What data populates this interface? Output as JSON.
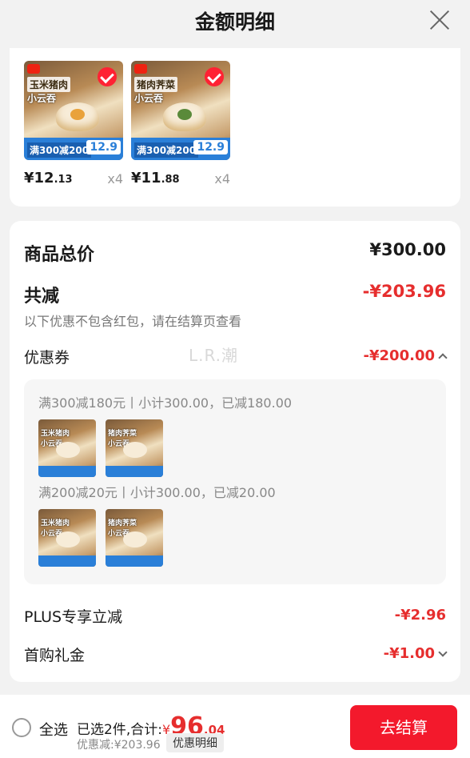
{
  "header": {
    "title": "金额明细"
  },
  "products": [
    {
      "line1": "玉米猪肉",
      "line2": "小云吞",
      "promo": "满300减200",
      "badge_price": "12.9",
      "price_int": "¥12",
      "price_dec": ".13",
      "qty": "x4",
      "filling": "corn"
    },
    {
      "line1": "猪肉荠菜",
      "line2": "小云吞",
      "promo": "满300减200",
      "badge_price": "12.9",
      "price_int": "¥11",
      "price_dec": ".88",
      "qty": "x4",
      "filling": "green"
    }
  ],
  "summary": {
    "total_label": "商品总价",
    "total_value": "¥300.00",
    "reduce_label": "共减",
    "reduce_value": "-¥203.96",
    "note": "以下优惠不包含红包，请在结算页查看",
    "coupon_label": "优惠券",
    "coupon_value": "-¥200.00",
    "watermark": "L.R.潮",
    "coupon_lines": [
      "满300减180元丨小计300.00，已减180.00",
      "满200减20元丨小计300.00，已减20.00"
    ],
    "plus_label": "PLUS专享立减",
    "plus_value": "-¥2.96",
    "first_label": "首购礼金",
    "first_value": "-¥1.00"
  },
  "bottom": {
    "select_all": "全选",
    "selected_text": "已选2件,合计:",
    "yen": "¥",
    "total_int": "96",
    "total_dec": ".04",
    "savings": "优惠减:¥203.96",
    "detail_tag": "优惠明细",
    "checkout": "去结算"
  },
  "colors": {
    "accent": "#e62e2e",
    "checkout": "#f3192c",
    "promo_bar": "#2a7fd8"
  }
}
